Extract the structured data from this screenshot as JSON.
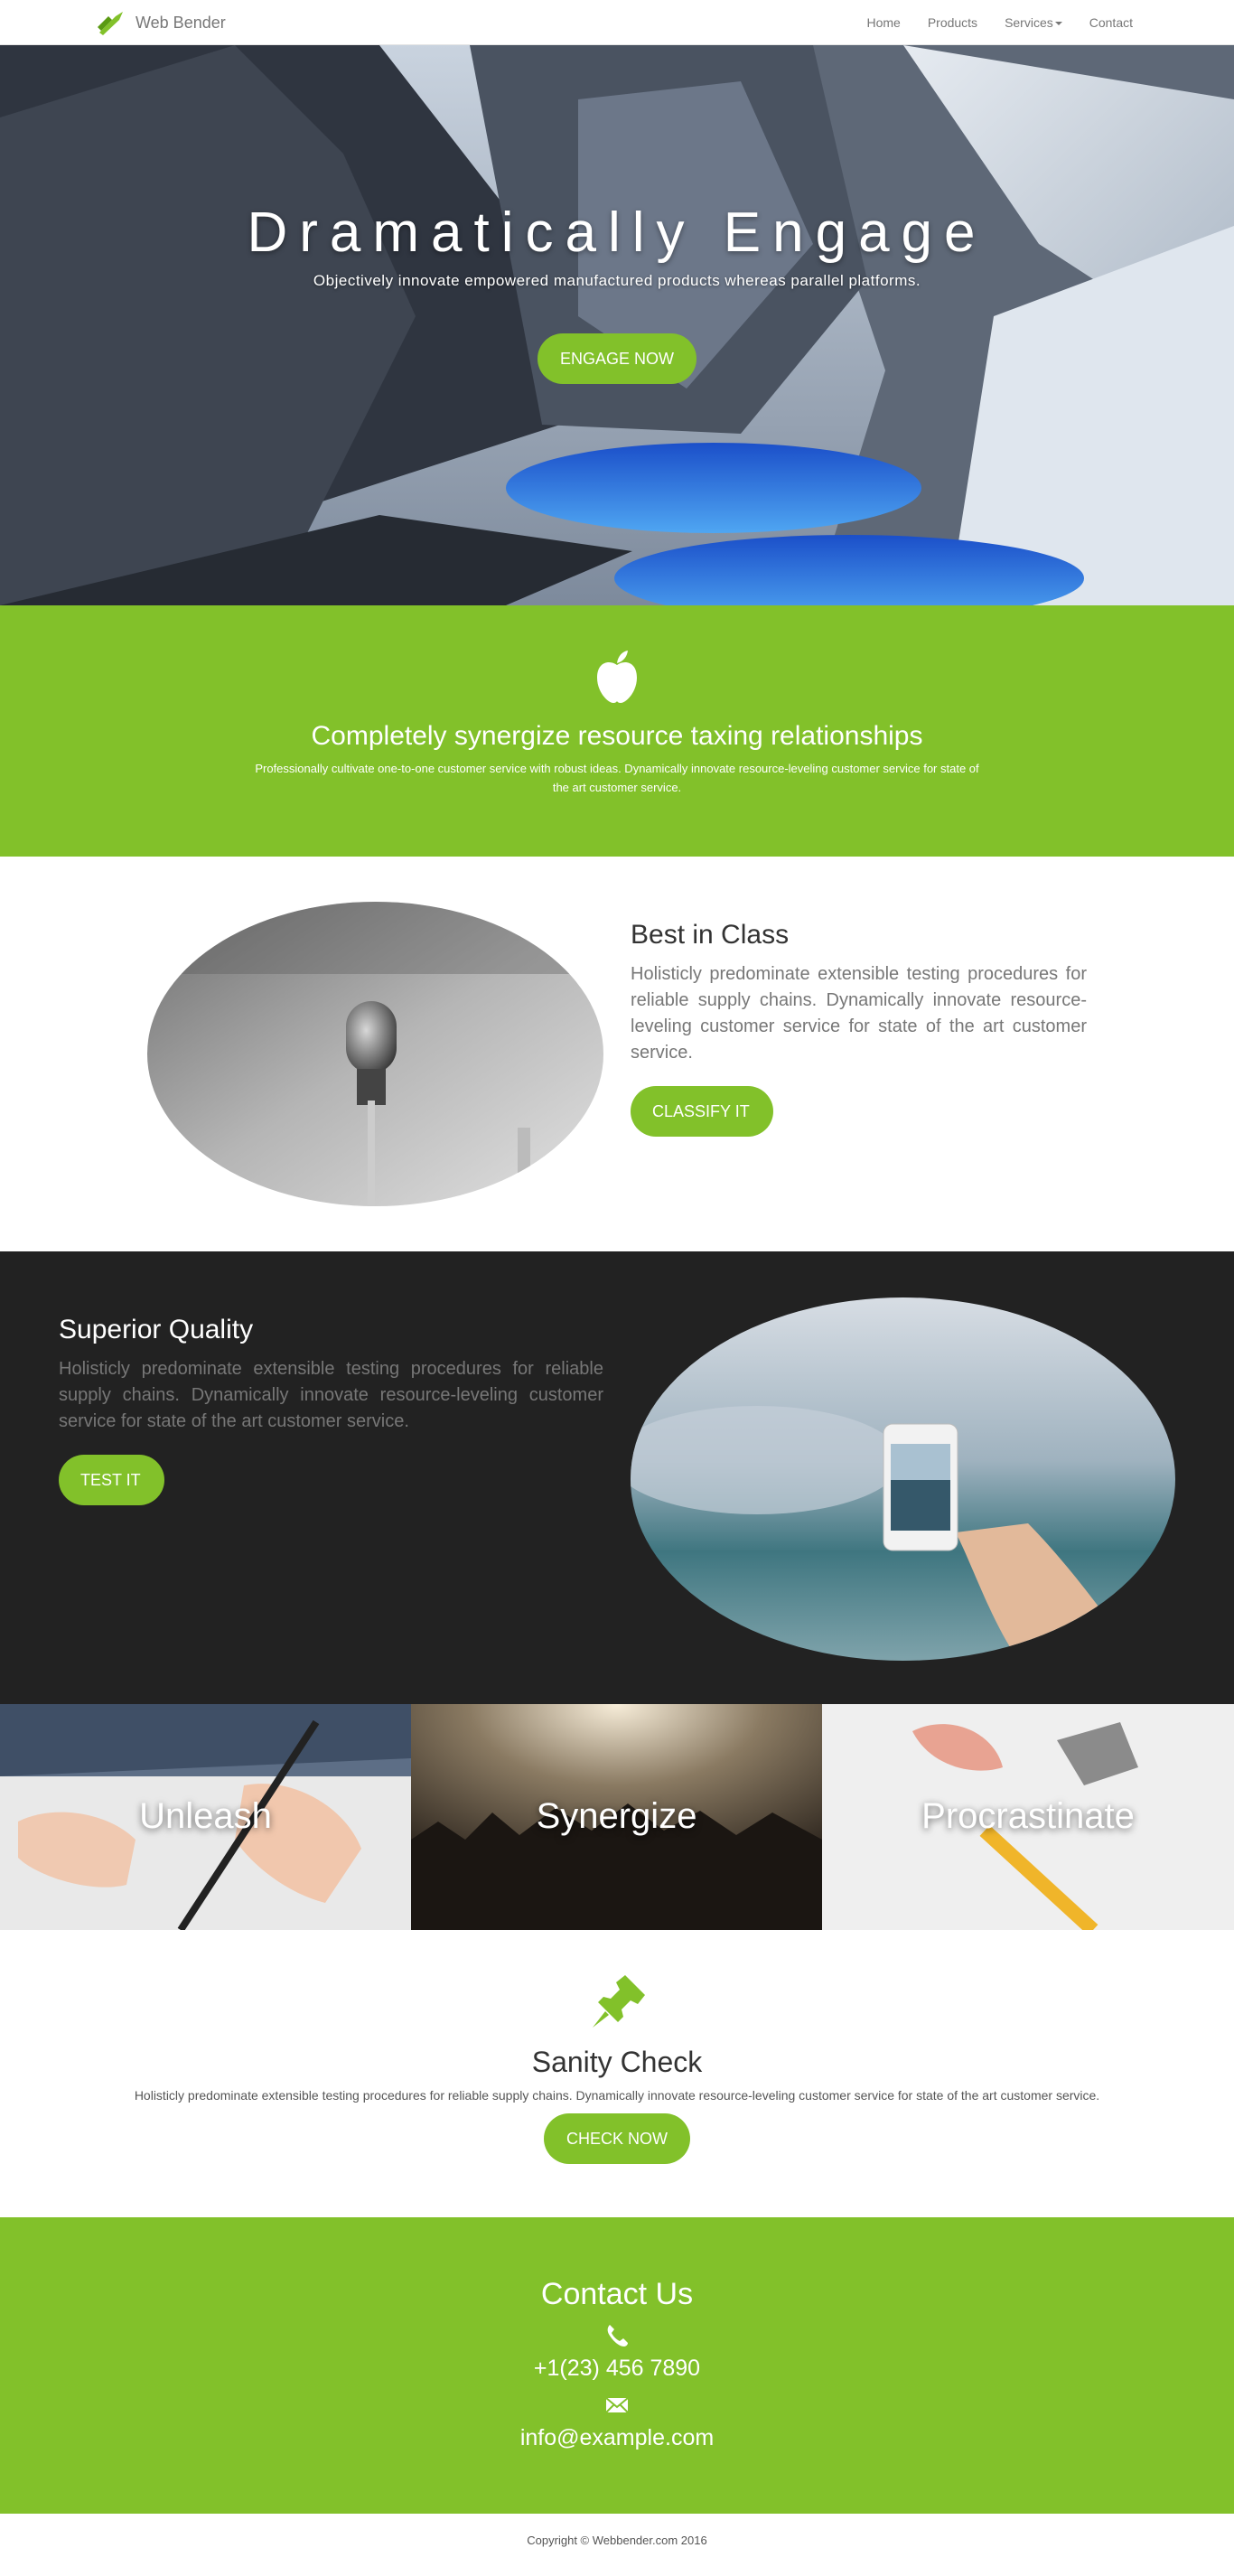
{
  "nav": {
    "brand": "Web Bender",
    "links": [
      "Home",
      "Products",
      "Services",
      "Contact"
    ]
  },
  "hero": {
    "title": "Dramatically Engage",
    "subtitle": "Objectively innovate empowered manufactured products whereas parallel platforms.",
    "button": "ENGAGE NOW"
  },
  "band": {
    "title": "Completely synergize resource taxing relationships",
    "text": "Professionally cultivate one-to-one customer service with robust ideas. Dynamically innovate resource-leveling customer service for state of the art customer service."
  },
  "feature1": {
    "title": "Best in Class",
    "text": "Holisticly predominate extensible testing procedures for reliable supply chains. Dynamically innovate resource-leveling customer service for state of the art customer service.",
    "button": "CLASSIFY IT"
  },
  "feature2": {
    "title": "Superior Quality",
    "text": "Holisticly predominate extensible testing procedures for reliable supply chains. Dynamically innovate resource-leveling customer service for state of the art customer service.",
    "button": "TEST IT"
  },
  "tiles": [
    "Unleash",
    "Synergize",
    "Procrastinate"
  ],
  "sanity": {
    "title": "Sanity Check",
    "text": "Holisticly predominate extensible testing procedures for reliable supply chains. Dynamically innovate resource-leveling customer service for state of the art customer service.",
    "button": "CHECK NOW"
  },
  "contact": {
    "title": "Contact Us",
    "phone": "+1(23) 456 7890",
    "email": "info@example.com"
  },
  "footer": {
    "text": "Copyright © Webbender.com 2016"
  },
  "colors": {
    "accent": "#82c12a",
    "dark": "#222222"
  }
}
